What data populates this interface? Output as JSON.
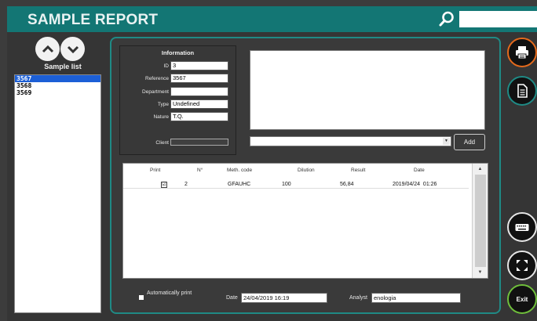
{
  "header": {
    "title": "SAMPLE REPORT",
    "search_value": ""
  },
  "sidebar": {
    "label": "Sample list",
    "samples": [
      "3567",
      "3568",
      "3569"
    ],
    "selected_index": 0
  },
  "info": {
    "title": "Information",
    "fields": {
      "id": {
        "label": "ID",
        "value": "3"
      },
      "reference": {
        "label": "Reference",
        "value": "3567"
      },
      "department": {
        "label": "Department",
        "value": ""
      },
      "type": {
        "label": "Type",
        "value": "Undefined"
      },
      "nature": {
        "label": "Nature",
        "value": "T.Q."
      },
      "client": {
        "label": "Client",
        "value": ""
      }
    }
  },
  "notes": {
    "value": ""
  },
  "combo": {
    "value": ""
  },
  "buttons": {
    "add": "Add",
    "exit": "Exit"
  },
  "table": {
    "columns": [
      "Print",
      "N°",
      "Meth. code",
      "Dilution",
      "Result",
      "Date"
    ],
    "rows": [
      {
        "print": true,
        "number": "2",
        "method": "GFAUHC",
        "dilution": "100",
        "result": "56,84",
        "date": "2019/04/24  01:26"
      }
    ]
  },
  "footer": {
    "auto_print_label": "Automatically print",
    "date_label": "Date",
    "date_value": "24/04/2019 16:19",
    "analyst_label": "Analyst",
    "analyst_value": "enologia"
  },
  "colors": {
    "header": "#137674",
    "accent_teal": "#1f8a85",
    "print_ring": "#e56a1c",
    "exit_ring": "#6fbf3b",
    "selection": "#1c5fd6"
  },
  "icons": [
    "search-icon",
    "chevron-up-icon",
    "chevron-down-icon",
    "printer-icon",
    "document-icon",
    "keyboard-icon",
    "fullscreen-icon"
  ]
}
